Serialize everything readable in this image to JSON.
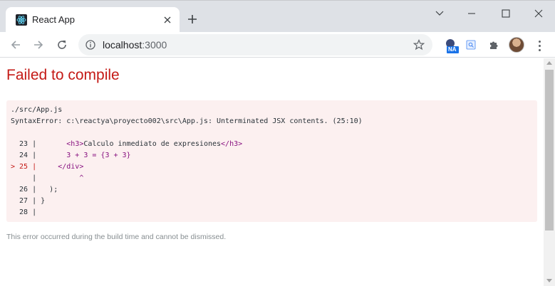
{
  "browser": {
    "tab": {
      "title": "React App",
      "favicon": "react-logo-icon"
    },
    "new_tab_icon": "plus-icon",
    "window_controls": [
      "chevron-down-icon",
      "minimize-icon",
      "maximize-icon",
      "close-icon"
    ],
    "address": {
      "host": "localhost",
      "port": ":3000"
    },
    "extensions": {
      "badge_text": "NA",
      "icons": [
        "na-extension-icon",
        "translate-extension-icon",
        "puzzle-icon"
      ]
    },
    "colors": {
      "tabstrip": "#dee1e6",
      "omnibox": "#f1f3f4"
    }
  },
  "page": {
    "title": "Failed to compile",
    "error": {
      "file": "./src/App.js",
      "message": "SyntaxError: c:\\reactya\\proyecto002\\src\\App.js: Unterminated JSX contents. (25:10)",
      "lines": {
        "l23_num": "  23 |",
        "l23_pre": "       ",
        "l23_open": "<h3>",
        "l23_text": "Calculo inmediato de expresiones",
        "l23_close": "</h3>",
        "l24_num": "  24 |",
        "l24_code": "       3 + 3 = {3 + 3}",
        "l25_num": "> 25 |",
        "l25_code": "     </div>",
        "caret_num": "     |",
        "caret": "          ^",
        "l26_num": "  26 |",
        "l26_code": "   );",
        "l27_num": "  27 |",
        "l27_code": " }",
        "l28_num": "  28 |"
      }
    },
    "footer": "This error occurred during the build time and cannot be dismissed.",
    "colors": {
      "title": "#c41a16",
      "box_bg": "#fcf0f0",
      "tag": "#881280"
    }
  }
}
